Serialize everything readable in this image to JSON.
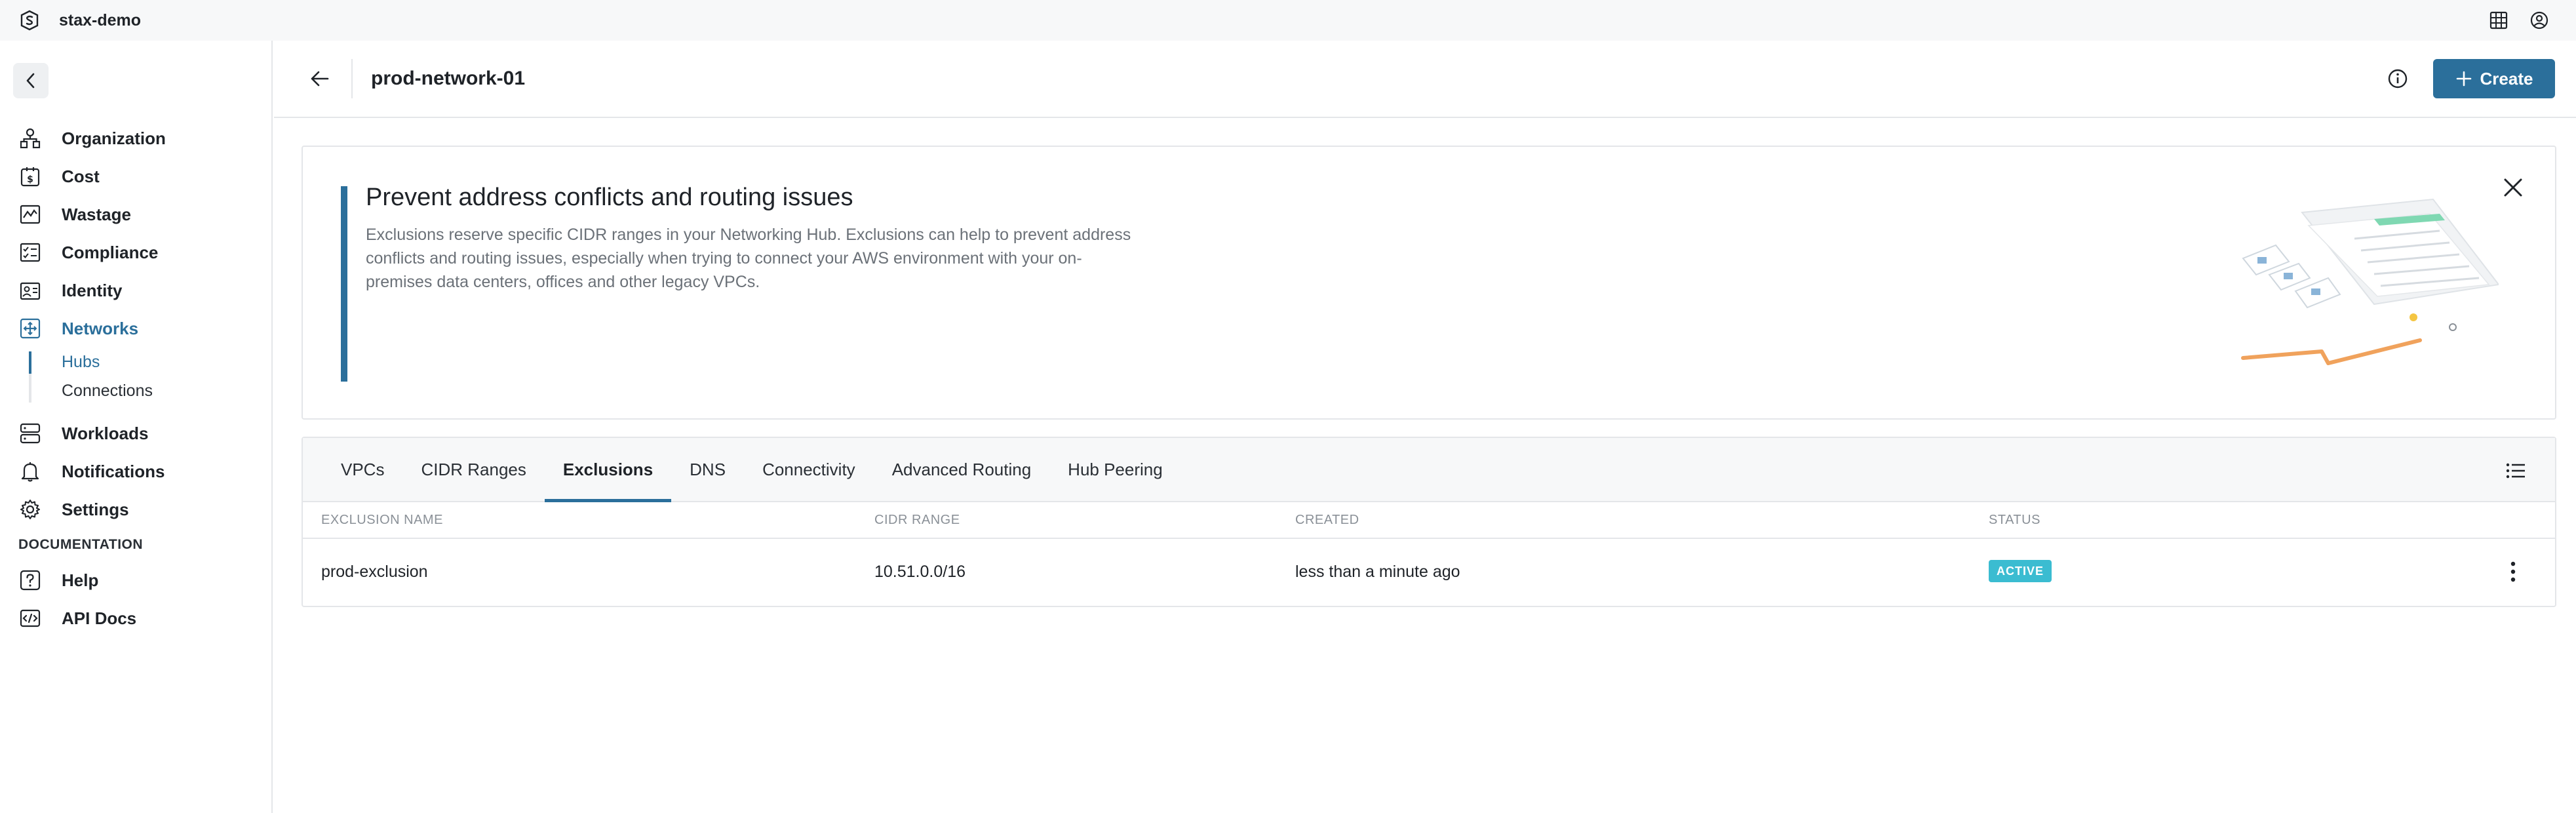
{
  "topbar": {
    "org_name": "stax-demo"
  },
  "sidebar": {
    "items": [
      {
        "label": "Organization",
        "icon": "organization-icon"
      },
      {
        "label": "Cost",
        "icon": "cost-icon"
      },
      {
        "label": "Wastage",
        "icon": "wastage-icon"
      },
      {
        "label": "Compliance",
        "icon": "compliance-icon"
      },
      {
        "label": "Identity",
        "icon": "identity-icon"
      },
      {
        "label": "Networks",
        "icon": "networks-icon",
        "active": true
      }
    ],
    "sub_items": [
      {
        "label": "Hubs",
        "active": true
      },
      {
        "label": "Connections"
      }
    ],
    "items2": [
      {
        "label": "Workloads",
        "icon": "workloads-icon"
      },
      {
        "label": "Notifications",
        "icon": "bell-icon"
      },
      {
        "label": "Settings",
        "icon": "gear-icon"
      }
    ],
    "docs_section": "DOCUMENTATION",
    "docs": [
      {
        "label": "Help",
        "icon": "help-icon"
      },
      {
        "label": "API Docs",
        "icon": "api-docs-icon"
      }
    ]
  },
  "header": {
    "title": "prod-network-01",
    "create_label": "Create"
  },
  "banner": {
    "title": "Prevent address conflicts and routing issues",
    "text": "Exclusions reserve specific CIDR ranges in your Networking Hub. Exclusions can help to prevent address conflicts and routing issues, especially when trying to connect your AWS environment with your on-premises data centers, offices and other legacy VPCs."
  },
  "tabs": [
    "VPCs",
    "CIDR Ranges",
    "Exclusions",
    "DNS",
    "Connectivity",
    "Advanced Routing",
    "Hub Peering"
  ],
  "active_tab": "Exclusions",
  "table": {
    "columns": [
      "EXCLUSION NAME",
      "CIDR RANGE",
      "CREATED",
      "STATUS"
    ],
    "rows": [
      {
        "name": "prod-exclusion",
        "cidr": "10.51.0.0/16",
        "created": "less than a minute ago",
        "status": "ACTIVE"
      }
    ]
  },
  "colors": {
    "accent": "#2b6f9b",
    "status_active": "#3bbcd1"
  }
}
